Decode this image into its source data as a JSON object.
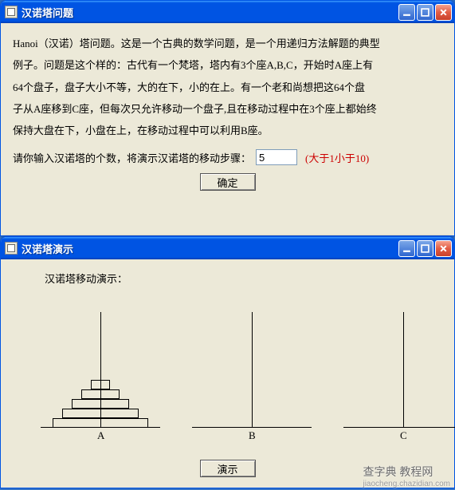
{
  "watermark": {
    "main": "查字典 教程网",
    "sub": "jiaocheng.chazidian.com"
  },
  "window1": {
    "title": "汉诺塔问题",
    "desc_lines": [
      "Hanoi（汉诺）塔问题。这是一个古典的数学问题，是一个用递归方法解题的典型",
      "例子。问题是这个样的：古代有一个梵塔，塔内有3个座A,B,C，开始时A座上有",
      "64个盘子，盘子大小不等，大的在下，小的在上。有一个老和尚想把这64个盘",
      "子从A座移到C座，但每次只允许移动一个盘子,且在移动过程中在3个座上都始终",
      "保持大盘在下，小盘在上，在移动过程中可以利用B座。"
    ],
    "prompt": "请你输入汉诺塔的个数，将演示汉诺塔的移动步骤：",
    "input_value": "5",
    "hint": "(大于1小于10)",
    "ok_button": "确定"
  },
  "window2": {
    "title": "汉诺塔演示",
    "heading": "汉诺塔移动演示：",
    "pegs": [
      "A",
      "B",
      "C"
    ],
    "demo_button": "演示"
  },
  "chart_data": {
    "type": "table",
    "initial_state": {
      "A": 5,
      "B": 0,
      "C": 0
    },
    "disk_widths": [
      24,
      48,
      72,
      96,
      120
    ]
  }
}
